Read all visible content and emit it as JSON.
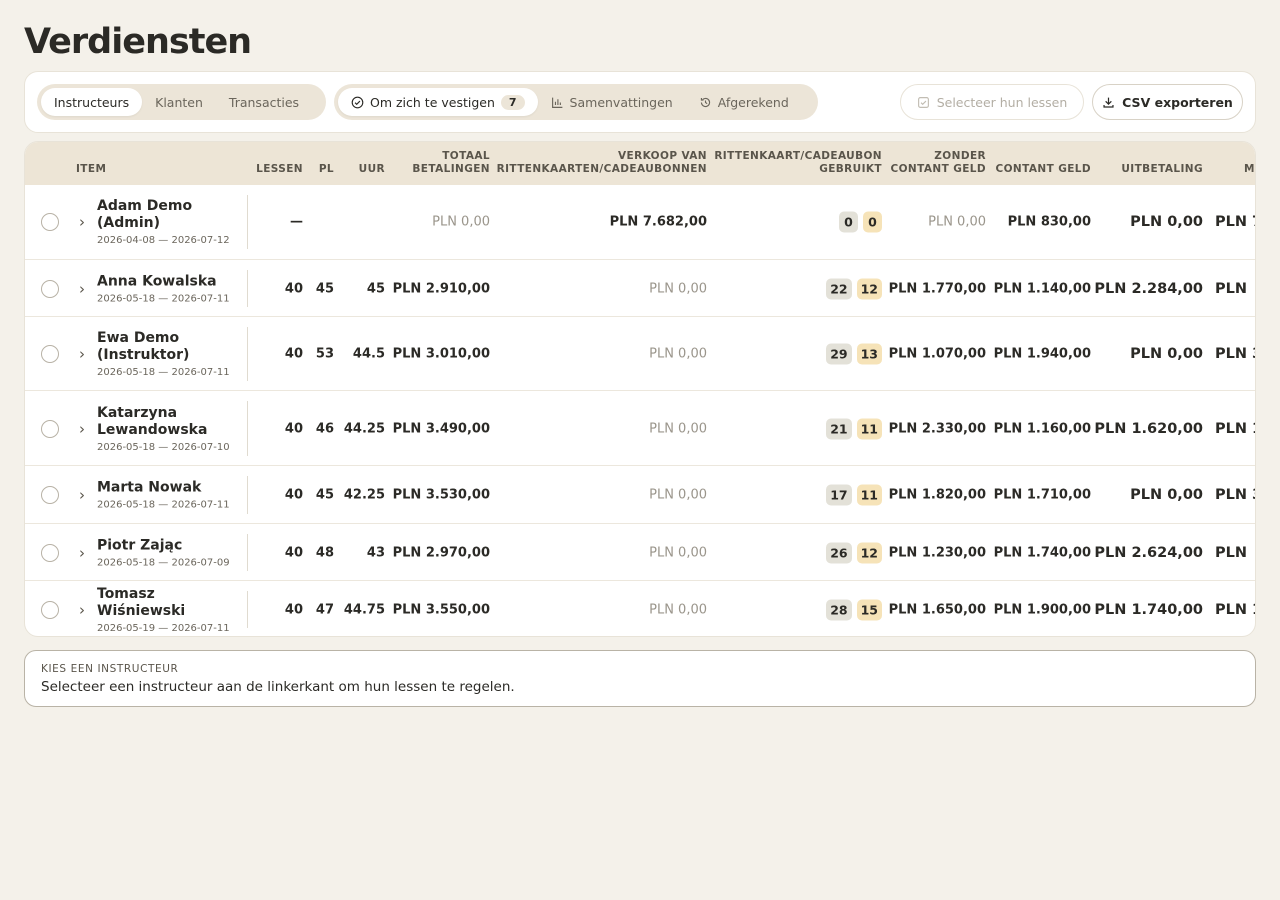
{
  "title": "Verdiensten",
  "tabs_primary": [
    "Instructeurs",
    "Klanten",
    "Transacties"
  ],
  "tabs_secondary": [
    {
      "label": "Om zich te vestigen",
      "icon": "check-circle-icon",
      "count": "7"
    },
    {
      "label": "Samenvattingen",
      "icon": "bar-chart-icon"
    },
    {
      "label": "Afgerekend",
      "icon": "history-icon"
    }
  ],
  "actions": {
    "select_label": "Selecteer hun lessen",
    "csv_label": "CSV exporteren"
  },
  "columns": {
    "item": "ITEM",
    "lessen": "LESSEN",
    "pl": "PL",
    "uur": "UUR",
    "totaal_1": "TOTAAL",
    "totaal_2": "BETALINGEN",
    "verkoop_1": "VERKOOP VAN",
    "verkoop_2": "RITTENKAARTEN/CADEAUBONNEN",
    "gebruikt_1": "RITTENKAART/CADEAUBON",
    "gebruikt_2": "GEBRUIKT",
    "zonder_1": "ZONDER",
    "zonder_2": "CONTANT GELD",
    "contant": "CONTANT GELD",
    "uitbetaling": "UITBETALING",
    "more": "M"
  },
  "rows": [
    {
      "name": "Adam Demo (Admin)",
      "dates": "2026-04-08 — 2026-07-12",
      "lessen": "—",
      "pl": "",
      "uur": "",
      "totaal": "PLN 0,00",
      "verkoop": "PLN 7.682,00",
      "b1": "0",
      "b2": "0",
      "zonder": "PLN 0,00",
      "contant": "PLN 830,00",
      "uitbetaling": "PLN 0,00",
      "extra": "PLN 7"
    },
    {
      "name": "Anna Kowalska",
      "dates": "2026-05-18 — 2026-07-11",
      "lessen": "40",
      "pl": "45",
      "uur": "45",
      "totaal": "PLN 2.910,00",
      "verkoop": "PLN 0,00",
      "b1": "22",
      "b2": "12",
      "zonder": "PLN 1.770,00",
      "contant": "PLN 1.140,00",
      "uitbetaling": "PLN 2.284,00",
      "extra": "PLN"
    },
    {
      "name": "Ewa Demo (Instruktor)",
      "dates": "2026-05-18 — 2026-07-11",
      "lessen": "40",
      "pl": "53",
      "uur": "44.5",
      "totaal": "PLN 3.010,00",
      "verkoop": "PLN 0,00",
      "b1": "29",
      "b2": "13",
      "zonder": "PLN 1.070,00",
      "contant": "PLN 1.940,00",
      "uitbetaling": "PLN 0,00",
      "extra": "PLN 3"
    },
    {
      "name": "Katarzyna Lewandowska",
      "dates": "2026-05-18 — 2026-07-10",
      "lessen": "40",
      "pl": "46",
      "uur": "44.25",
      "totaal": "PLN 3.490,00",
      "verkoop": "PLN 0,00",
      "b1": "21",
      "b2": "11",
      "zonder": "PLN 2.330,00",
      "contant": "PLN 1.160,00",
      "uitbetaling": "PLN 1.620,00",
      "extra": "PLN 1"
    },
    {
      "name": "Marta Nowak",
      "dates": "2026-05-18 — 2026-07-11",
      "lessen": "40",
      "pl": "45",
      "uur": "42.25",
      "totaal": "PLN 3.530,00",
      "verkoop": "PLN 0,00",
      "b1": "17",
      "b2": "11",
      "zonder": "PLN 1.820,00",
      "contant": "PLN 1.710,00",
      "uitbetaling": "PLN 0,00",
      "extra": "PLN 3"
    },
    {
      "name": "Piotr Zając",
      "dates": "2026-05-18 — 2026-07-09",
      "lessen": "40",
      "pl": "48",
      "uur": "43",
      "totaal": "PLN 2.970,00",
      "verkoop": "PLN 0,00",
      "b1": "26",
      "b2": "12",
      "zonder": "PLN 1.230,00",
      "contant": "PLN 1.740,00",
      "uitbetaling": "PLN 2.624,00",
      "extra": "PLN"
    },
    {
      "name": "Tomasz Wiśniewski",
      "dates": "2026-05-19 — 2026-07-11",
      "lessen": "40",
      "pl": "47",
      "uur": "44.75",
      "totaal": "PLN 3.550,00",
      "verkoop": "PLN 0,00",
      "b1": "28",
      "b2": "15",
      "zonder": "PLN 1.650,00",
      "contant": "PLN 1.900,00",
      "uitbetaling": "PLN 1.740,00",
      "extra": "PLN 1"
    }
  ],
  "info": {
    "label": "KIES EEN INSTRUCTEUR",
    "text": "Selecteer een instructeur aan de linkerkant om hun lessen te regelen."
  }
}
